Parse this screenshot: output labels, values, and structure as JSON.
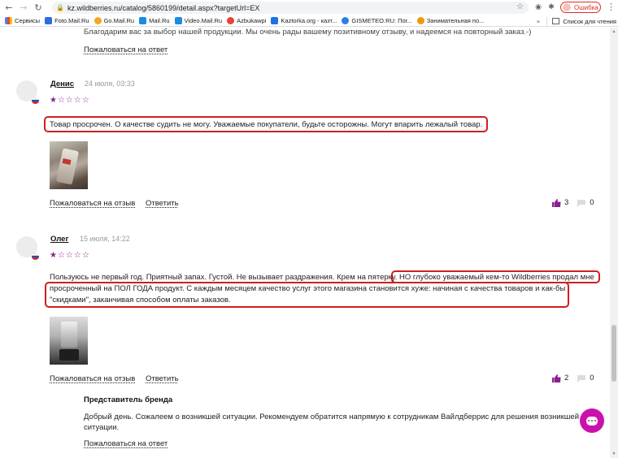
{
  "browser": {
    "url": "kz.wildberries.ru/catalog/5860199/detail.aspx?targetUrl=EX",
    "error_label": "Ошибка",
    "bookmarks": [
      "Сервисы",
      "Foto.Mail.Ru",
      "Go.Mail.Ru",
      "Mail.Ru",
      "Video.Mail.Ru",
      "Azbukawpi",
      "Kaztorka.org - казт...",
      "GISMETEO.RU: Пог...",
      "Занимательная по..."
    ],
    "bookmark_colors": [
      "#4285f4",
      "#2d6cdf",
      "#f5a623",
      "#168de2",
      "#168de2",
      "#e94235",
      "#1a73e8",
      "#2b7de9",
      "#f29900"
    ],
    "overflow": "»",
    "reading_list": "Список для чтения"
  },
  "page": {
    "prev_reply_text": "Благодарим вас за выбор нашей продукции. Мы очень рады вашему позитивному отзыву, и надеемся на повторный заказ.-)",
    "prev_complain": "Пожаловаться на ответ",
    "reviews": [
      {
        "name": "Денис",
        "date": "24 июля, 03:33",
        "rating": 1,
        "text_lines": [
          "Товар просрочен. О качестве судить не могу. Уважаемые покупатели, будьте осторожны. Могут впарить лежалый товар."
        ],
        "complain": "Пожаловаться на отзыв",
        "reply": "Ответить",
        "likes": "3",
        "dislikes": "0"
      },
      {
        "name": "Олег",
        "date": "15 июля, 14:22",
        "rating": 1,
        "text_lines": [
          "Пользуюсь не первый год. Приятный запах. Густой. Не вызывает раздражения. Крем на пятерку. НО глубоко уважаемый кем-то Wildberries продал мне",
          "просроченный на ПОЛ ГОДА продукт. С каждым месяцем качество услуг этого магазина становится хуже: начиная с качества товаров и как-бы",
          "\"скидками\", заканчивая способом оплаты заказов."
        ],
        "complain": "Пожаловаться на отзыв",
        "reply": "Ответить",
        "likes": "2",
        "dislikes": "0"
      }
    ],
    "brand_reply": {
      "title": "Представитель бренда",
      "text_lines": [
        "Добрый день. Сожалеем о возникшей ситуации. Рекомендуем обратится напрямую к сотрудникам Вайлдберрис для решения возникшей",
        "ситуации."
      ],
      "complain": "Пожаловаться на ответ"
    },
    "colors": {
      "accent": "#cb11ab",
      "highlight": "#d01e1e",
      "star": "#8b1f8f"
    }
  }
}
